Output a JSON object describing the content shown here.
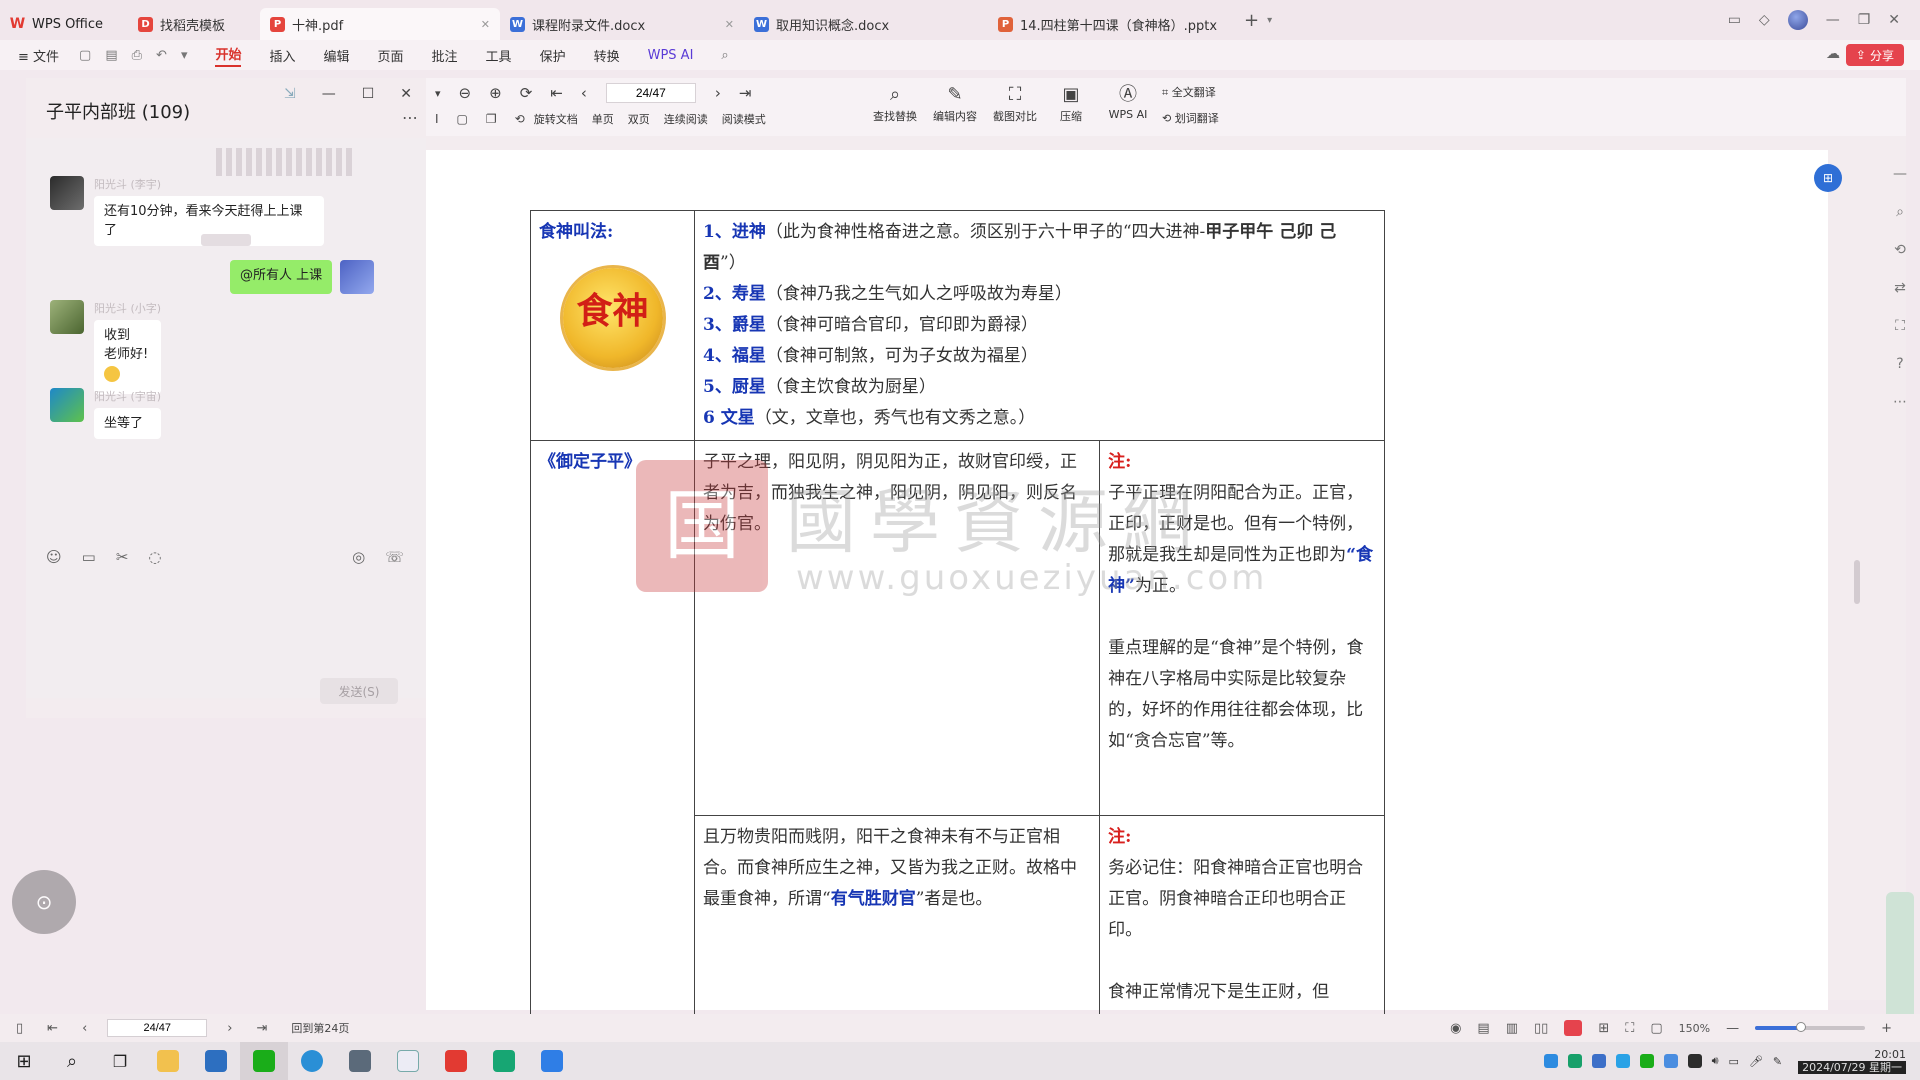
{
  "titlebar": {
    "tabs": [
      {
        "label": "WPS Office",
        "icon": "wps-logo-icon",
        "kind": "home"
      },
      {
        "label": "找稻壳模板",
        "icon": "docer-icon",
        "kind": "pdf"
      },
      {
        "label": "十神.pdf",
        "icon": "pdf-icon",
        "kind": "pdf",
        "active": true
      },
      {
        "label": "课程附录文件.docx",
        "icon": "word-icon",
        "kind": "doc"
      },
      {
        "label": "取用知识概念.docx",
        "icon": "word-icon",
        "kind": "doc"
      },
      {
        "label": "14.四柱第十四课（食神格）.pptx",
        "icon": "ppt-icon",
        "kind": "ppt"
      }
    ]
  },
  "menubar": {
    "file": "≡ 文件",
    "items": [
      "开始",
      "插入",
      "编辑",
      "页面",
      "批注",
      "工具",
      "保护",
      "转换",
      "WPS AI"
    ],
    "active": "开始",
    "share": "分享"
  },
  "chat": {
    "title": "子平内部班 (109)",
    "messages": [
      {
        "sender": "阳光斗 (李宇)",
        "text": "还有10分钟，看来今天赶得上上课了"
      },
      {
        "sender": "",
        "text": "@所有人  上课",
        "mine": true
      },
      {
        "sender": "阳光斗 (小字)",
        "text": "收到\n老师好!"
      },
      {
        "sender": "阳光斗 (宇宙)",
        "text": "坐等了"
      }
    ],
    "send_label": "发送(S)"
  },
  "pdf_toolbar": {
    "page_value": "24/47",
    "row2": [
      "旋转文档",
      "单页",
      "双页",
      "连续阅读",
      "阅读模式"
    ],
    "tools": [
      "查找替换",
      "编辑内容",
      "截图对比",
      "压缩",
      "WPS AI",
      "划词翻译"
    ],
    "full_translate": "全文翻译"
  },
  "document": {
    "r1c1_title": "食神叫法:",
    "seal_char": "食神",
    "r1_items": [
      {
        "num": "1、",
        "name": "进神",
        "desc": "（此为食神性格奋进之意。须区别于六十甲子的“四大进神-",
        "extra": "甲子甲午 己卯 己酉",
        "tail": "”）"
      },
      {
        "num": "2、",
        "name": "寿星",
        "desc": "（食神乃我之生气如人之呼吸故为寿星）"
      },
      {
        "num": "3、",
        "name": "爵星",
        "desc": "（食神可暗合官印，官印即为爵禄）"
      },
      {
        "num": "4、",
        "name": "福星",
        "desc": "（食神可制煞，可为子女故为福星）"
      },
      {
        "num": "5、",
        "name": "厨星",
        "desc": "（食主饮食故为厨星）"
      },
      {
        "num": "6  ",
        "name": "文星",
        "desc": "（文，文章也，秀气也有文秀之意。）"
      }
    ],
    "r2c1_title": "《御定子平》",
    "r2c2_text": "子平之理，阳见阴，阴见阳为正，故财官印绶，正者为吉，而独我生之神，阳见阴，阴见阳，则反名为伤官。",
    "r2c3_label": "注:",
    "r2c3_p1a": "子平正理在阴阳配合为正。正官，正印，正财是也。但有一个特例，那就是我生却是同性为正也即为",
    "r2c3_p1_hl": "“食神”",
    "r2c3_p1b": "为正。",
    "r2c3_p2": "重点理解的是“食神”是个特例，食神在八字格局中实际是比较复杂的，好坏的作用往往都会体现，比如“贪合忘官”等。",
    "r3c2_a": "且万物贵阳而贱阴，阳干之食神未有不与正官相合。而食神所应生之神，又皆为我之正财。故格中最重食神，所谓“",
    "r3c2_hl": "有气胜财官",
    "r3c2_b": "”者是也。",
    "r3c3_label": "注:",
    "r3c3_p1": "务必记住：阳食神暗合正官也明合正官。阴食神暗合正印也明合正印。",
    "r3c3_p2": "食神正常情况下是生正财，但"
  },
  "watermark": {
    "seal": "国",
    "text": "國學資源網",
    "url": "www.guoxueziyuan.com"
  },
  "statusbar": {
    "page_value": "24/47",
    "back_label": "回到第24页",
    "zoom": "150%",
    "zoom_fraction": 0.42
  },
  "clock": {
    "time": "20:01",
    "date": "2024/07/29 星期一"
  },
  "colors": {
    "accent": "#d9322c",
    "blue_term": "#1736b4",
    "red_note": "#d8201e",
    "chat_green": "#95ec69"
  }
}
